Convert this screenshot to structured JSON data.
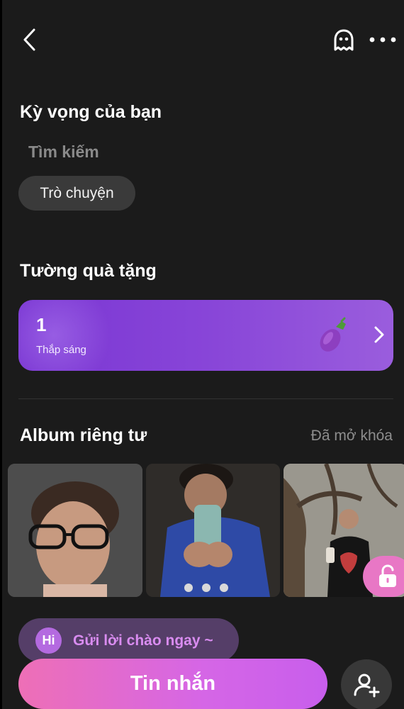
{
  "header": {
    "back_icon": "chevron-left-icon",
    "ghost_icon": "ghost-icon",
    "more_icon": "more-horizontal-icon"
  },
  "expectations": {
    "title": "Kỳ vọng của bạn",
    "search_label": "Tìm kiếm",
    "chip_label": "Trò chuyện"
  },
  "gift_wall": {
    "title": "Tường quà tặng",
    "count": "1",
    "label": "Thắp sáng",
    "gift_icon": "eggplant-icon"
  },
  "album": {
    "title": "Album riêng tư",
    "status": "Đã mở khóa",
    "photos": [
      "photo-1",
      "photo-2",
      "photo-3"
    ]
  },
  "greeting": {
    "badge": "Hi",
    "text": "Gửi lời chào ngay ~"
  },
  "actions": {
    "message_label": "Tin nhắn",
    "add_friend_icon": "add-user-icon"
  },
  "colors": {
    "background": "#1b1b1b",
    "gift_card": "#8845d8",
    "message_button": "#e06bd0",
    "accent_pink": "#e877c5"
  }
}
